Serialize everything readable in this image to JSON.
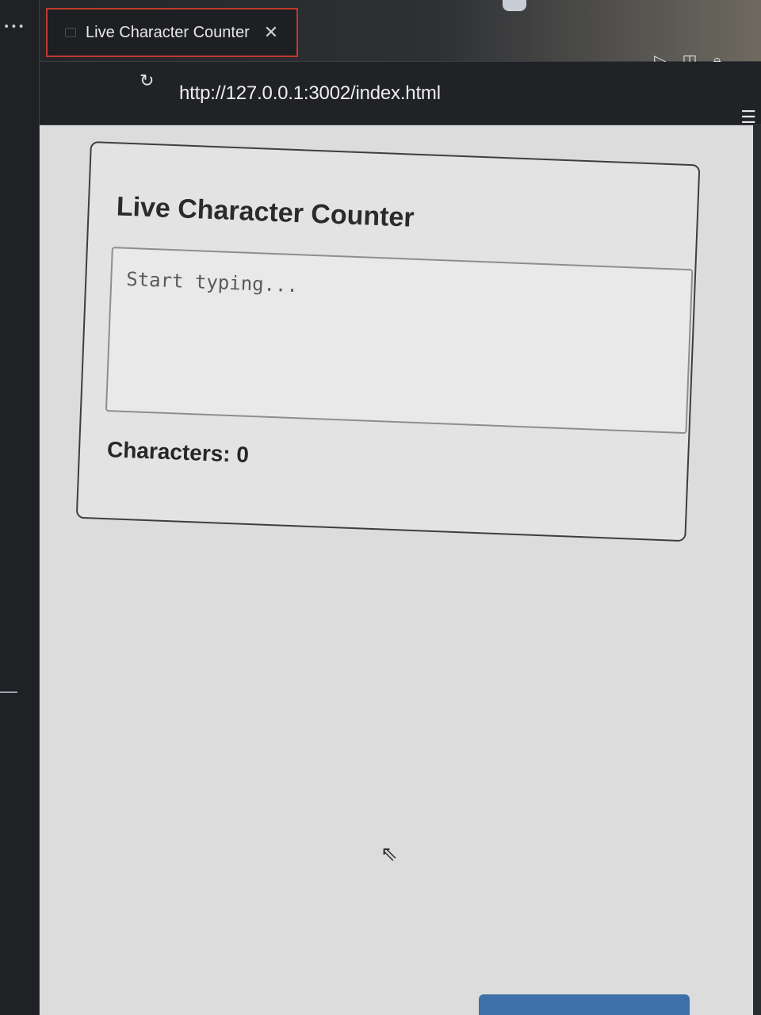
{
  "window": {
    "tab_title": "Live Character Counter",
    "url": "http://127.0.0.1:3002/index.html"
  },
  "icons": {
    "gutter": "more-dots-icon",
    "tab": "file-icon",
    "close": "close-icon",
    "reload": "reload-icon",
    "run": "play-icon",
    "split": "split-editor-icon",
    "lock": "lock-icon",
    "more": "more-icon",
    "menu": "menu-icon",
    "cursor": "mouse-cursor-icon"
  },
  "app": {
    "heading": "Live Character Counter",
    "input_placeholder": "Start typing...",
    "input_value": "",
    "counter_label": "Characters: 0",
    "char_count": 0
  },
  "colors": {
    "tab_border": "#c0392b",
    "accent_button": "#3d6fa8"
  }
}
